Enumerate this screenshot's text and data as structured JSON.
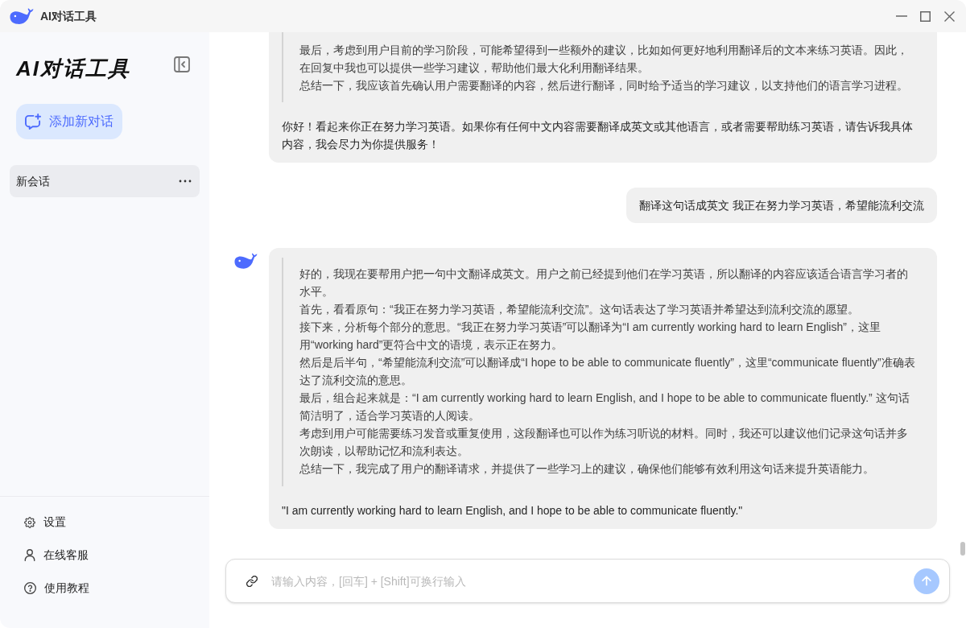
{
  "window": {
    "title": "AI对话工具"
  },
  "sidebar": {
    "title": "AI对话工具",
    "new_chat": "添加新对话",
    "sessions": [
      {
        "title": "新会话",
        "selected": true
      }
    ],
    "menu": [
      {
        "kind": "settings",
        "label": "设置"
      },
      {
        "kind": "support",
        "label": "在线客服"
      },
      {
        "kind": "help",
        "label": "使用教程"
      }
    ]
  },
  "messages": [
    {
      "kind": "assistant",
      "cut_off": true,
      "reasoning": [
        "最后，考虑到用户目前的学习阶段，可能希望得到一些额外的建议，比如如何更好地利用翻译后的文本来练习英语。因此，在回复中我也可以提供一些学习建议，帮助他们最大化利用翻译结果。",
        "总结一下，我应该首先确认用户需要翻译的内容，然后进行翻译，同时给予适当的学习建议，以支持他们的语言学习进程。"
      ],
      "answer": "你好！看起来你正在努力学习英语。如果你有任何中文内容需要翻译成英文或其他语言，或者需要帮助练习英语，请告诉我具体内容，我会尽力为你提供服务！"
    },
    {
      "kind": "user",
      "text": "翻译这句话成英文 我正在努力学习英语，希望能流利交流"
    },
    {
      "kind": "assistant",
      "cut_off": false,
      "reasoning": [
        "好的，我现在要帮用户把一句中文翻译成英文。用户之前已经提到他们在学习英语，所以翻译的内容应该适合语言学习者的水平。",
        "首先，看看原句：“我正在努力学习英语，希望能流利交流”。这句话表达了学习英语并希望达到流利交流的愿望。",
        "接下来，分析每个部分的意思。“我正在努力学习英语”可以翻译为“I am currently working hard to learn English”，这里用“working hard”更符合中文的语境，表示正在努力。",
        "然后是后半句，“希望能流利交流”可以翻译成“I hope to be able to communicate fluently”，这里“communicate fluently”准确表达了流利交流的意思。",
        "最后，组合起来就是：“I am currently working hard to learn English, and I hope to be able to communicate fluently.” 这句话简洁明了，适合学习英语的人阅读。",
        "考虑到用户可能需要练习发音或重复使用，这段翻译也可以作为练习听说的材料。同时，我还可以建议他们记录这句话并多次朗读，以帮助记忆和流利表达。",
        "总结一下，我完成了用户的翻译请求，并提供了一些学习上的建议，确保他们能够有效利用这句话来提升英语能力。"
      ],
      "answer": "\"I am currently working hard to learn English, and I hope to be able to communicate fluently.\""
    }
  ],
  "composer": {
    "placeholder": "请输入内容，[回车] + [Shift]可换行输入"
  }
}
